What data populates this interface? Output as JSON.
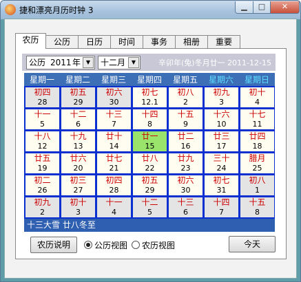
{
  "window": {
    "title": "捷和漂亮月历时钟 3"
  },
  "tabs": [
    {
      "label": "农历",
      "active": true
    },
    {
      "label": "公历"
    },
    {
      "label": "日历"
    },
    {
      "label": "时间"
    },
    {
      "label": "事务"
    },
    {
      "label": "相册"
    },
    {
      "label": "重要"
    }
  ],
  "controls": {
    "calendar_mode": "公历",
    "year": "2011",
    "year_suffix": "年",
    "month": "十二月",
    "lunar_header": "辛卯年(兔)冬月廿一  2011-12-15"
  },
  "weekdays": [
    "星期一",
    "星期二",
    "星期三",
    "星期四",
    "星期五",
    "星期六",
    "星期日"
  ],
  "weeks": [
    [
      {
        "lunar": "初四",
        "greg": "28",
        "other": true
      },
      {
        "lunar": "初五",
        "greg": "29",
        "other": true
      },
      {
        "lunar": "初六",
        "greg": "30",
        "other": true
      },
      {
        "lunar": "初七",
        "greg": "12.1"
      },
      {
        "lunar": "初八",
        "greg": "2"
      },
      {
        "lunar": "初九",
        "greg": "3"
      },
      {
        "lunar": "初十",
        "greg": "4"
      }
    ],
    [
      {
        "lunar": "十一",
        "greg": "5"
      },
      {
        "lunar": "十二",
        "greg": "6"
      },
      {
        "lunar": "十三",
        "greg": "7"
      },
      {
        "lunar": "十四",
        "greg": "8"
      },
      {
        "lunar": "十五",
        "greg": "9"
      },
      {
        "lunar": "十六",
        "greg": "10"
      },
      {
        "lunar": "十七",
        "greg": "11"
      }
    ],
    [
      {
        "lunar": "十八",
        "greg": "12"
      },
      {
        "lunar": "十九",
        "greg": "13"
      },
      {
        "lunar": "廿十",
        "greg": "14"
      },
      {
        "lunar": "廿一",
        "greg": "15",
        "today": true
      },
      {
        "lunar": "廿二",
        "greg": "16"
      },
      {
        "lunar": "廿三",
        "greg": "17"
      },
      {
        "lunar": "廿四",
        "greg": "18"
      }
    ],
    [
      {
        "lunar": "廿五",
        "greg": "19"
      },
      {
        "lunar": "廿六",
        "greg": "20"
      },
      {
        "lunar": "廿七",
        "greg": "21"
      },
      {
        "lunar": "廿八",
        "greg": "22"
      },
      {
        "lunar": "廿九",
        "greg": "23"
      },
      {
        "lunar": "三十",
        "greg": "24"
      },
      {
        "lunar": "腊月",
        "greg": "25"
      }
    ],
    [
      {
        "lunar": "初二",
        "greg": "26"
      },
      {
        "lunar": "初三",
        "greg": "27"
      },
      {
        "lunar": "初四",
        "greg": "28"
      },
      {
        "lunar": "初五",
        "greg": "29"
      },
      {
        "lunar": "初六",
        "greg": "30"
      },
      {
        "lunar": "初七",
        "greg": "31"
      },
      {
        "lunar": "初八",
        "greg": "1",
        "other": true
      }
    ],
    [
      {
        "lunar": "初九",
        "greg": "2",
        "other": true
      },
      {
        "lunar": "初十",
        "greg": "3",
        "other": true
      },
      {
        "lunar": "十一",
        "greg": "4",
        "other": true
      },
      {
        "lunar": "十二",
        "greg": "5",
        "other": true
      },
      {
        "lunar": "十三",
        "greg": "6",
        "other": true
      },
      {
        "lunar": "十四",
        "greg": "7",
        "other": true
      },
      {
        "lunar": "十五",
        "greg": "8",
        "other": true
      }
    ]
  ],
  "solar_terms": "十三大雪  廿八冬至",
  "footer": {
    "explain_button": "农历说明",
    "radio_solar": "公历视图",
    "radio_lunar": "农历视图",
    "today_button": "今天"
  },
  "colors": {
    "weekday_header_bg": "#3d6fb6",
    "weekend_header_text": "#5ee0ff",
    "lunar_text": "#c00000",
    "today_bg": "#9be46c",
    "other_month_bg": "#e4e4e4",
    "grid_line": "#0a2fd0"
  }
}
